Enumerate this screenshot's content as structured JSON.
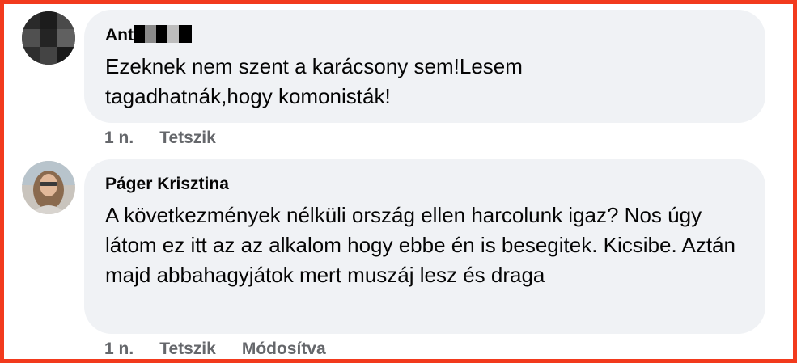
{
  "comments": [
    {
      "author": "Ant",
      "text": "Ezeknek nem szent a karácsony sem!Lesem tagadhatnák,hogy komonisták!",
      "time": "1 n.",
      "like": "Tetszik"
    },
    {
      "author": "Páger Krisztina",
      "text": "A következmények nélküli ország ellen harcolunk igaz? Nos úgy látom ez itt az az alkalom hogy ebbe én is besegitek. Kicsibe. Aztán majd abbahagyjátok mert muszáj lesz és draga",
      "time": "1 n.",
      "like": "Tetszik",
      "edited": "Módosítva"
    }
  ]
}
